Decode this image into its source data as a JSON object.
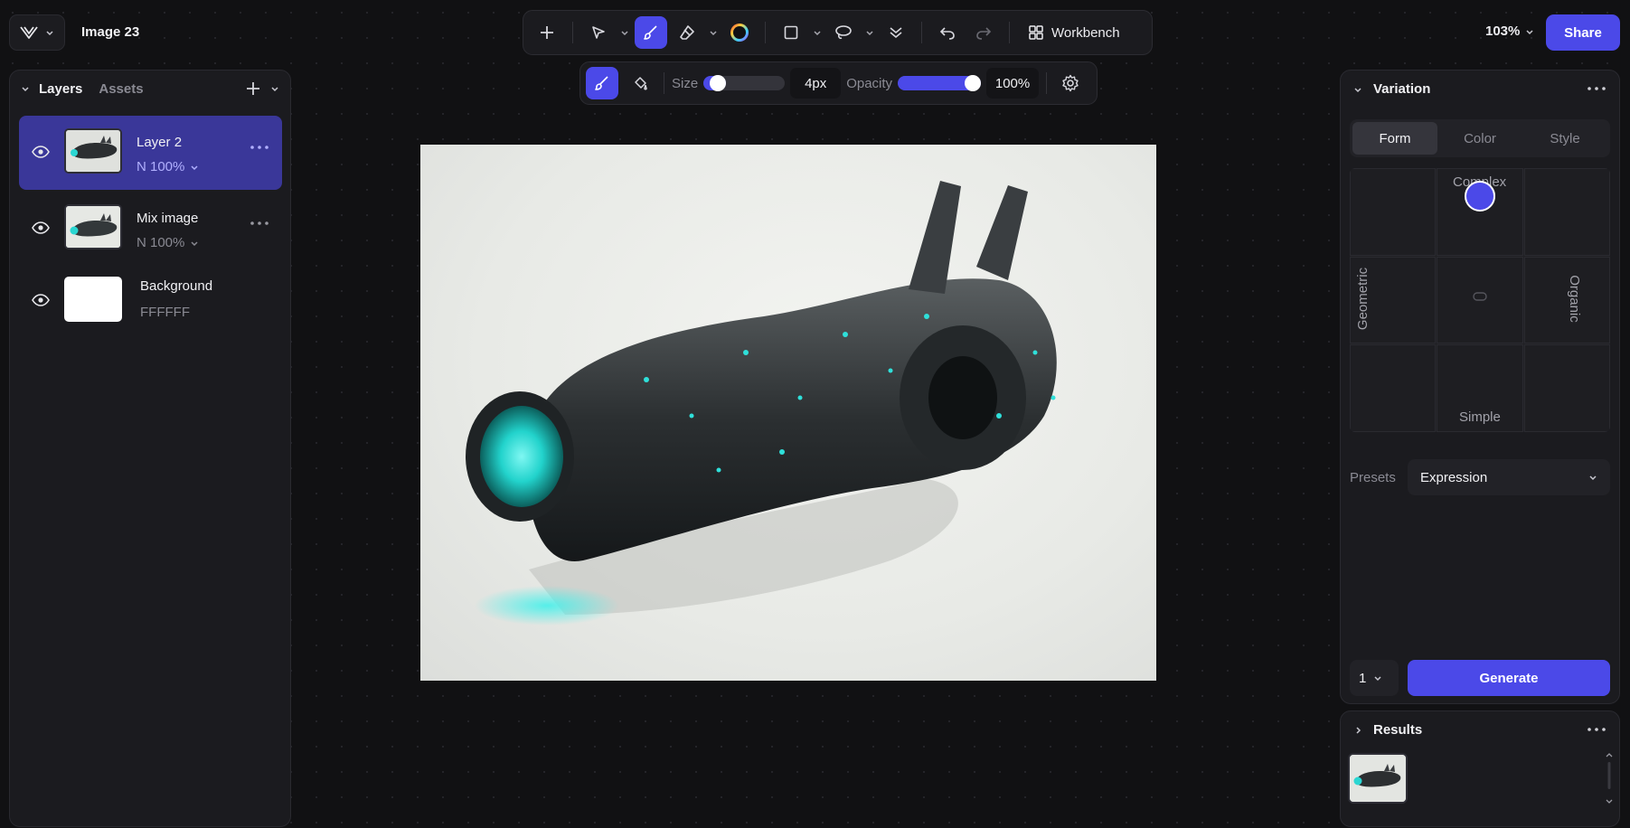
{
  "app": {
    "document_title": "Image 23",
    "zoom": "103%",
    "share_label": "Share"
  },
  "toolbar": {
    "workbench_label": "Workbench"
  },
  "brush": {
    "size_label": "Size",
    "size_value": "4px",
    "size_fraction": 0.1,
    "opacity_label": "Opacity",
    "opacity_value": "100%",
    "opacity_fraction": 1.0
  },
  "left_panel": {
    "tabs": [
      {
        "label": "Layers",
        "active": true
      },
      {
        "label": "Assets",
        "active": false
      }
    ],
    "layers": [
      {
        "name": "Layer 2",
        "sub": "N 100%",
        "selected": true
      },
      {
        "name": "Mix image",
        "sub": "N 100%",
        "selected": false
      },
      {
        "name": "Background",
        "sub": "FFFFFF",
        "selected": false
      }
    ]
  },
  "right_panel": {
    "title": "Variation",
    "segments": [
      {
        "label": "Form",
        "active": true
      },
      {
        "label": "Color",
        "active": false
      },
      {
        "label": "Style",
        "active": false
      }
    ],
    "pad": {
      "top": "Complex",
      "bottom": "Simple",
      "left": "Geometric",
      "right": "Organic"
    },
    "presets_label": "Presets",
    "presets_value": "Expression",
    "count_value": "1",
    "generate_label": "Generate"
  },
  "results_panel": {
    "title": "Results"
  },
  "colors": {
    "accent": "#4b49e8",
    "selected_row": "#3a3799",
    "panel_bg": "#1b1b1f",
    "app_bg": "#111113"
  }
}
